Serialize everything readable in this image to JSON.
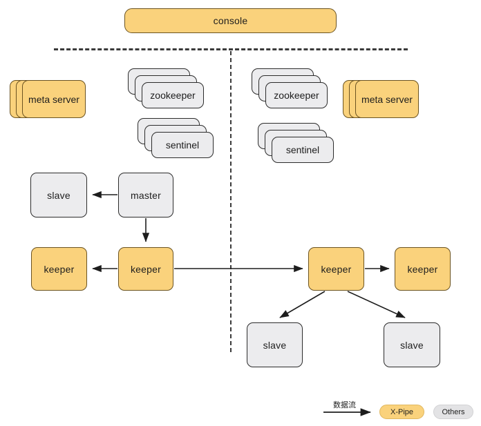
{
  "diagram": {
    "title": "console",
    "colors": {
      "xpipe_fill": "#fad27c",
      "others_fill": "#ececee",
      "stroke": "#2b2b2b",
      "divider": "#3a3a3a"
    },
    "console": {
      "label": "console"
    },
    "left_cluster": {
      "meta_server": {
        "label": "meta server",
        "count": 3
      },
      "zookeeper": {
        "label": "zookeeper",
        "count": 3
      },
      "sentinel": {
        "label": "sentinel",
        "count": 3
      }
    },
    "right_cluster": {
      "meta_server": {
        "label": "meta server",
        "count": 3
      },
      "zookeeper": {
        "label": "zookeeper",
        "count": 3
      },
      "sentinel": {
        "label": "sentinel",
        "count": 3
      }
    },
    "left_region": {
      "slave": {
        "label": "slave"
      },
      "master": {
        "label": "master"
      },
      "keeper_outer": {
        "label": "keeper"
      },
      "keeper_inner": {
        "label": "keeper"
      }
    },
    "right_region": {
      "keeper_inner": {
        "label": "keeper"
      },
      "keeper_outer": {
        "label": "keeper"
      },
      "slave_left": {
        "label": "slave"
      },
      "slave_right": {
        "label": "slave"
      }
    },
    "legend": {
      "flow_label": "数据流",
      "xpipe_label": "X-Pipe",
      "others_label": "Others"
    }
  }
}
